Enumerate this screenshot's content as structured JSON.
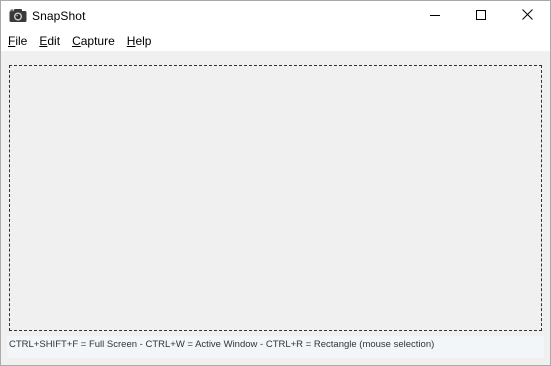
{
  "window": {
    "title": "SnapShot",
    "app_icon": "camera-icon",
    "controls": {
      "minimize_icon": "minimize-icon",
      "maximize_icon": "maximize-icon",
      "close_icon": "close-icon"
    }
  },
  "menu": {
    "items": [
      {
        "mnemonic": "F",
        "rest": "ile"
      },
      {
        "mnemonic": "E",
        "rest": "dit"
      },
      {
        "mnemonic": "C",
        "rest": "apture"
      },
      {
        "mnemonic": "H",
        "rest": "elp"
      }
    ]
  },
  "status": {
    "text": "CTRL+SHIFT+F = Full Screen  -  CTRL+W = Active Window  -  CTRL+R = Rectangle (mouse selection)"
  }
}
